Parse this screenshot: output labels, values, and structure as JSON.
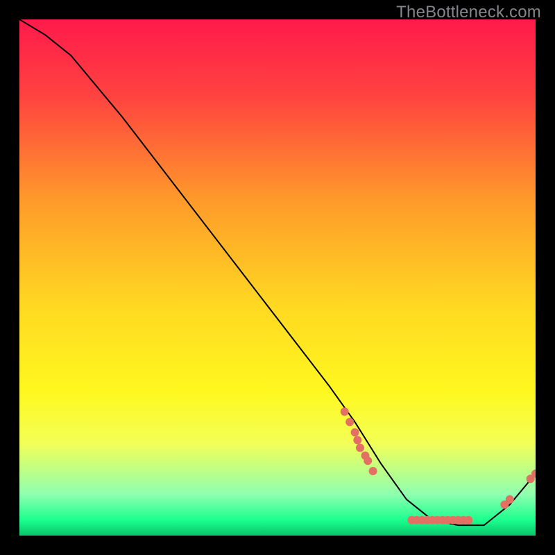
{
  "watermark": "TheBottleneck.com",
  "chart_data": {
    "type": "line",
    "title": "",
    "xlabel": "",
    "ylabel": "",
    "xlim": [
      0,
      100
    ],
    "ylim": [
      0,
      100
    ],
    "grid": false,
    "background": {
      "type": "vertical-gradient",
      "stops": [
        {
          "pos": 0.0,
          "color": "#ff1a4b"
        },
        {
          "pos": 0.15,
          "color": "#ff4340"
        },
        {
          "pos": 0.35,
          "color": "#ff9a2a"
        },
        {
          "pos": 0.55,
          "color": "#ffd722"
        },
        {
          "pos": 0.72,
          "color": "#fff81f"
        },
        {
          "pos": 0.82,
          "color": "#f3ff55"
        },
        {
          "pos": 0.92,
          "color": "#8fffb0"
        },
        {
          "pos": 0.97,
          "color": "#1bff8e"
        },
        {
          "pos": 1.0,
          "color": "#07c56a"
        }
      ]
    },
    "series": [
      {
        "name": "bottleneck-curve",
        "color": "#000000",
        "x": [
          0,
          5,
          10,
          20,
          30,
          40,
          50,
          60,
          65,
          70,
          75,
          80,
          85,
          90,
          95,
          100
        ],
        "y": [
          100,
          97,
          93,
          81,
          68,
          55,
          42,
          29,
          22,
          14,
          7,
          3,
          2,
          2,
          6,
          12
        ]
      }
    ],
    "markers": {
      "name": "highlighted-points",
      "color": "#e27164",
      "points": [
        {
          "x": 63,
          "y": 24
        },
        {
          "x": 64,
          "y": 22
        },
        {
          "x": 65,
          "y": 20
        },
        {
          "x": 65.5,
          "y": 18.5
        },
        {
          "x": 66,
          "y": 17
        },
        {
          "x": 67,
          "y": 15.5
        },
        {
          "x": 67.5,
          "y": 14.5
        },
        {
          "x": 68.5,
          "y": 12.5
        },
        {
          "x": 76,
          "y": 3
        },
        {
          "x": 77,
          "y": 3
        },
        {
          "x": 78,
          "y": 3
        },
        {
          "x": 79,
          "y": 3
        },
        {
          "x": 80,
          "y": 3
        },
        {
          "x": 81,
          "y": 3
        },
        {
          "x": 82,
          "y": 3
        },
        {
          "x": 83,
          "y": 3
        },
        {
          "x": 84,
          "y": 3
        },
        {
          "x": 85,
          "y": 3
        },
        {
          "x": 86,
          "y": 3
        },
        {
          "x": 87,
          "y": 3
        },
        {
          "x": 94,
          "y": 6
        },
        {
          "x": 95,
          "y": 7
        },
        {
          "x": 99,
          "y": 11
        },
        {
          "x": 100,
          "y": 12
        }
      ]
    }
  }
}
